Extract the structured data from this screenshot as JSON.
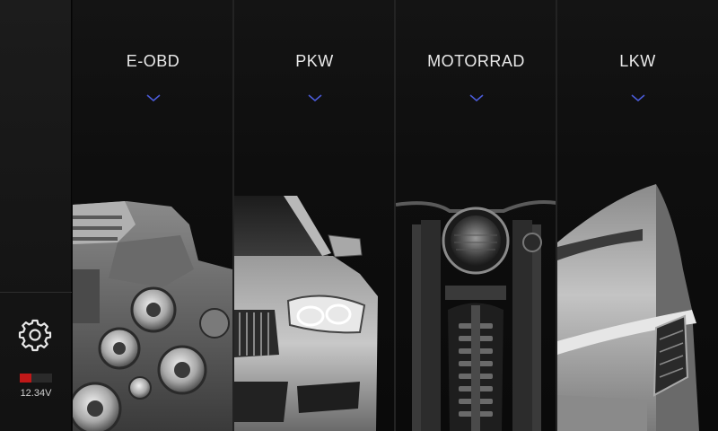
{
  "sidebar": {
    "settings_icon": "gear-icon",
    "battery_level": 0.35,
    "battery_color": "#c01818",
    "voltage": "12.34V"
  },
  "panels": [
    {
      "label": "E-OBD",
      "image": "engine",
      "chevron_icon": "chevron-down-icon"
    },
    {
      "label": "PKW",
      "image": "car",
      "chevron_icon": "chevron-down-icon"
    },
    {
      "label": "MOTORRAD",
      "image": "motorcycle",
      "chevron_icon": "chevron-down-icon"
    },
    {
      "label": "LKW",
      "image": "truck",
      "chevron_icon": "chevron-down-icon"
    }
  ],
  "accent_color": "#4a5bd8"
}
